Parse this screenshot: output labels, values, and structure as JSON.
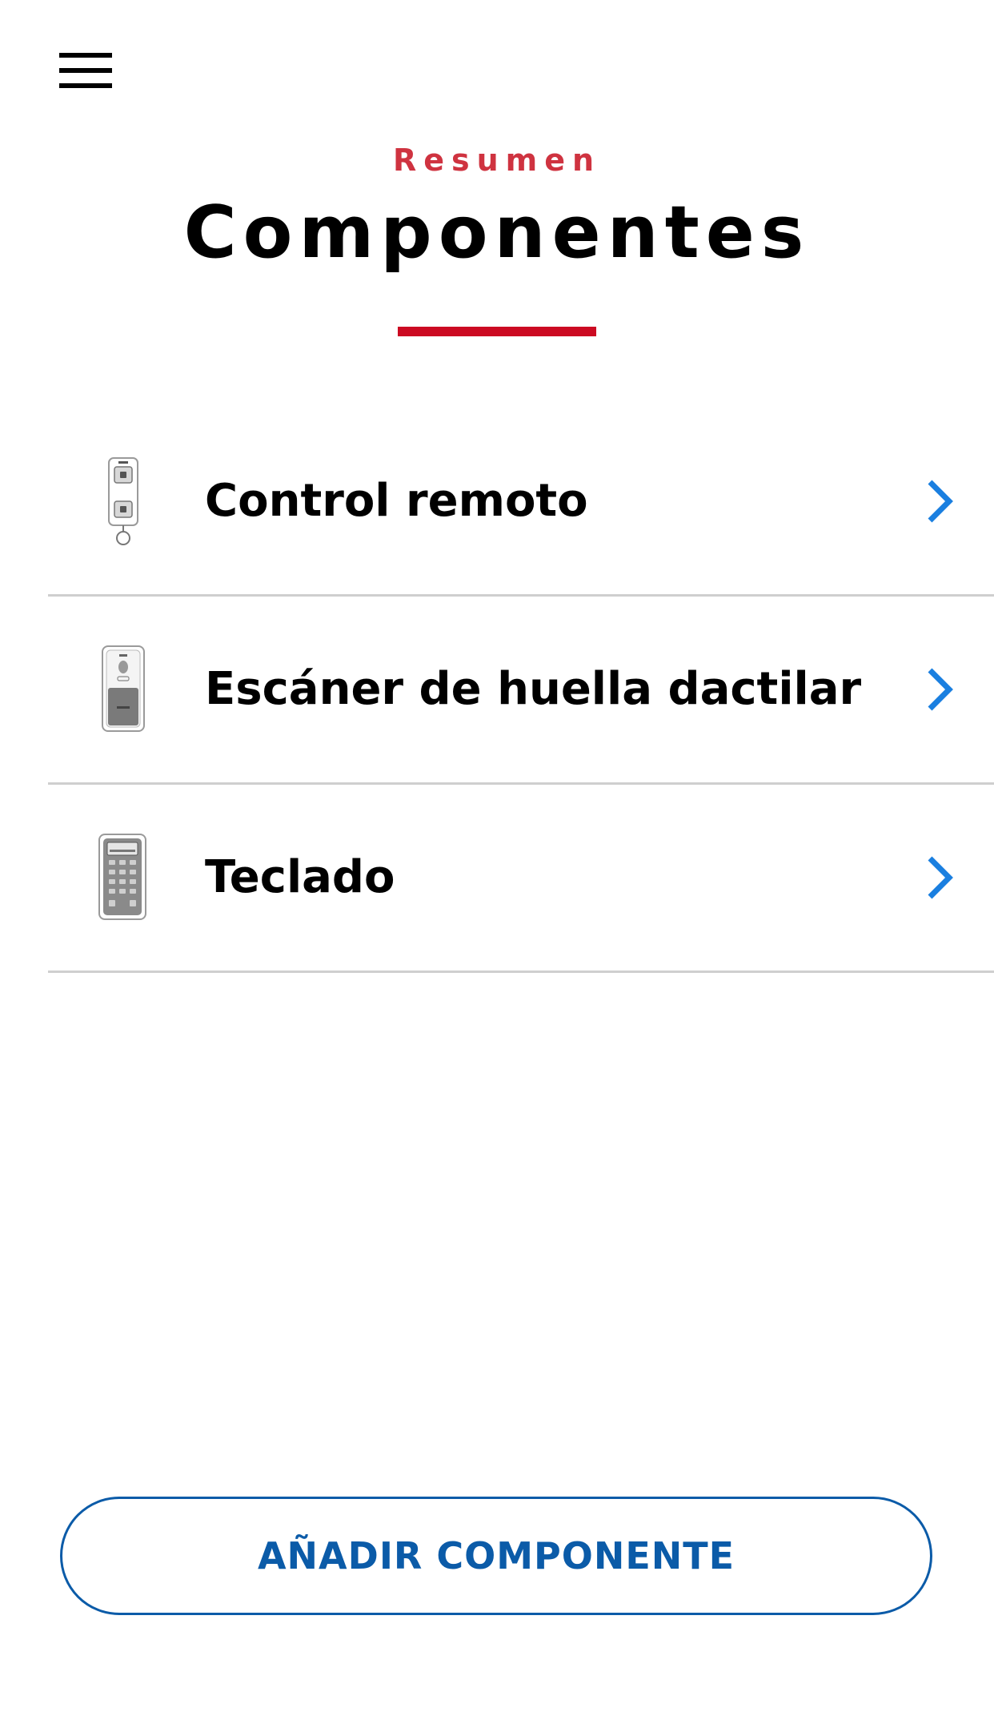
{
  "header": {
    "subtitle": "Resumen",
    "title": "Componentes"
  },
  "components": [
    {
      "label": "Control remoto",
      "icon": "remote-control-icon"
    },
    {
      "label": "Escáner de huella dactilar",
      "icon": "fingerprint-scanner-icon"
    },
    {
      "label": "Teclado",
      "icon": "keypad-icon"
    }
  ],
  "actions": {
    "add_component_label": "AÑADIR COMPONENTE"
  },
  "colors": {
    "accent_red": "#cc0a22",
    "subtitle_red": "#cf3340",
    "link_blue": "#0b5ba8",
    "chevron_blue": "#1a7fe0",
    "divider": "#cfcfcf"
  }
}
